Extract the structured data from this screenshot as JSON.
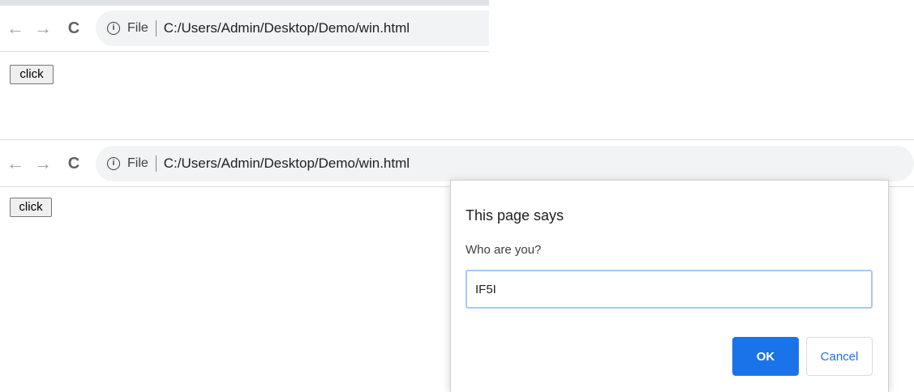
{
  "top_window": {
    "nav": {
      "back_icon": "←",
      "forward_icon": "→",
      "reload_icon": "C"
    },
    "omnibox": {
      "info_icon": "i",
      "scheme_label": "File",
      "url": "C:/Users/Admin/Desktop/Demo/win.html"
    },
    "page": {
      "button_label": "click"
    }
  },
  "bottom_window": {
    "nav": {
      "back_icon": "←",
      "forward_icon": "→",
      "reload_icon": "C"
    },
    "omnibox": {
      "info_icon": "i",
      "scheme_label": "File",
      "url": "C:/Users/Admin/Desktop/Demo/win.html"
    },
    "page": {
      "button_label": "click"
    },
    "prompt_dialog": {
      "title": "This page says",
      "message": "Who are you?",
      "input_value": "IF5I",
      "ok_label": "OK",
      "cancel_label": "Cancel"
    }
  },
  "colors": {
    "accent": "#1a73e8",
    "omnibox_bg": "#f1f3f4",
    "input_focus_border": "#a8c7fa"
  }
}
